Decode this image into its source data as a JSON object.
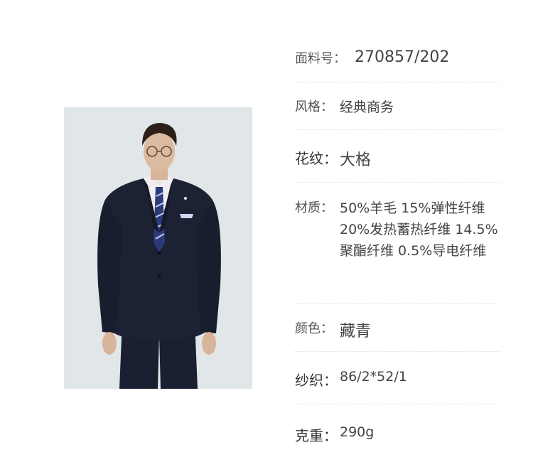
{
  "photo": {
    "alt_subject": "model-in-navy-suit"
  },
  "specs": [
    {
      "label": "面料号：",
      "value": "270857/202"
    },
    {
      "label": "风格：",
      "value": "经典商务"
    },
    {
      "label": "花纹：",
      "value": "大格"
    },
    {
      "label": "材质：",
      "value": "50%羊毛 15%弹性纤维 20%发热蓄热纤维 14.5%聚酯纤维 0.5%导电纤维"
    },
    {
      "label": "颜色：",
      "value": "藏青"
    },
    {
      "label": "纱织：",
      "value": "86/2*52/1"
    },
    {
      "label": "克重：",
      "value": "290g"
    }
  ],
  "colors": {
    "suit": "#1c2234",
    "background": "#e1e6e8",
    "divider": "#e4e4e4"
  }
}
